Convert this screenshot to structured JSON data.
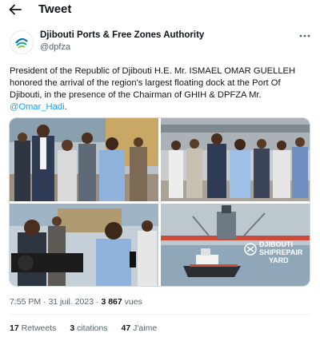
{
  "header": {
    "title": "Tweet",
    "back_icon": "arrow-left-icon"
  },
  "author": {
    "name": "Djibouti Ports & Free Zones Authority",
    "handle": "@dpfza",
    "more_icon": "more-icon"
  },
  "tweet": {
    "text": "President of the Republic of Djibouti H.E. Mr. ISMAEL OMAR GUELLEH honored the arrival of the region's largest floating dock at the Port Of Djibouti, in the presence of the Chairman of GHIH & DPFZA Mr. ",
    "mention": "@Omar_Hadi",
    "period": "."
  },
  "media": {
    "watermark_line1": "DJIBOUTI",
    "watermark_line2": "SHIPREPAIR",
    "watermark_line3": "YARD"
  },
  "meta": {
    "time": "7:55 PM",
    "separator": "·",
    "date": "31 juil. 2023",
    "views_count": "3 867",
    "views_label": "vues"
  },
  "stats": {
    "retweets_count": "17",
    "retweets_label": "Retweets",
    "quotes_count": "3",
    "quotes_label": "citations",
    "likes_count": "47",
    "likes_label": "J'aime"
  },
  "colors": {
    "link": "#1d9bf0",
    "secondary": "#536471",
    "text": "#0f1419"
  }
}
